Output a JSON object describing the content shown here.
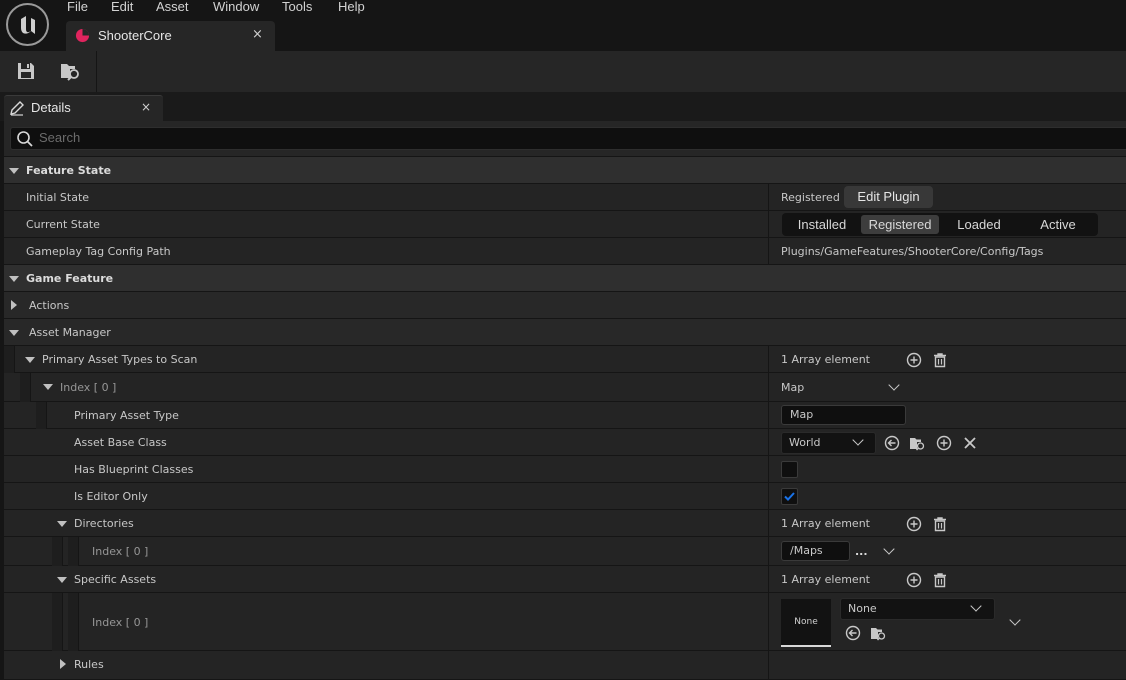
{
  "menu": [
    "File",
    "Edit",
    "Asset",
    "Window",
    "Tools",
    "Help"
  ],
  "document_tab": {
    "label": "ShooterCore",
    "close": "×"
  },
  "details_tab": {
    "label": "Details",
    "close": "×"
  },
  "search": {
    "placeholder": "Search"
  },
  "sections": {
    "feature_state": "Feature State",
    "game_feature": "Game Feature"
  },
  "rows": {
    "initial_state": {
      "label": "Initial State",
      "value": "Registered",
      "button": "Edit Plugin"
    },
    "current_state": {
      "label": "Current State",
      "states": [
        "Installed",
        "Registered",
        "Loaded",
        "Active"
      ],
      "selected": "Registered"
    },
    "tag_config_path": {
      "label": "Gameplay Tag Config Path",
      "value": "Plugins/GameFeatures/ShooterCore/Config/Tags"
    },
    "actions": {
      "label": "Actions"
    },
    "asset_manager": {
      "label": "Asset Manager"
    },
    "primary_asset_types": {
      "label": "Primary Asset Types to Scan",
      "value": "1 Array element"
    },
    "index0": {
      "label": "Index [ 0 ]",
      "value": "Map"
    },
    "primary_asset_type": {
      "label": "Primary Asset Type",
      "value": "Map"
    },
    "asset_base_class": {
      "label": "Asset Base Class",
      "value": "World"
    },
    "has_blueprint_classes": {
      "label": "Has Blueprint Classes",
      "checked": false
    },
    "is_editor_only": {
      "label": "Is Editor Only",
      "checked": true
    },
    "directories": {
      "label": "Directories",
      "value": "1 Array element"
    },
    "dir_index0": {
      "label": "Index [ 0 ]",
      "value": "/Maps",
      "more": "..."
    },
    "specific_assets": {
      "label": "Specific Assets",
      "value": "1 Array element"
    },
    "spec_index0": {
      "label": "Index [ 0 ]",
      "thumbnail": "None",
      "combo": "None"
    },
    "rules": {
      "label": "Rules"
    }
  },
  "colors": {
    "accent_check": "#1a73e8",
    "tab_icon": "#e0245e"
  }
}
